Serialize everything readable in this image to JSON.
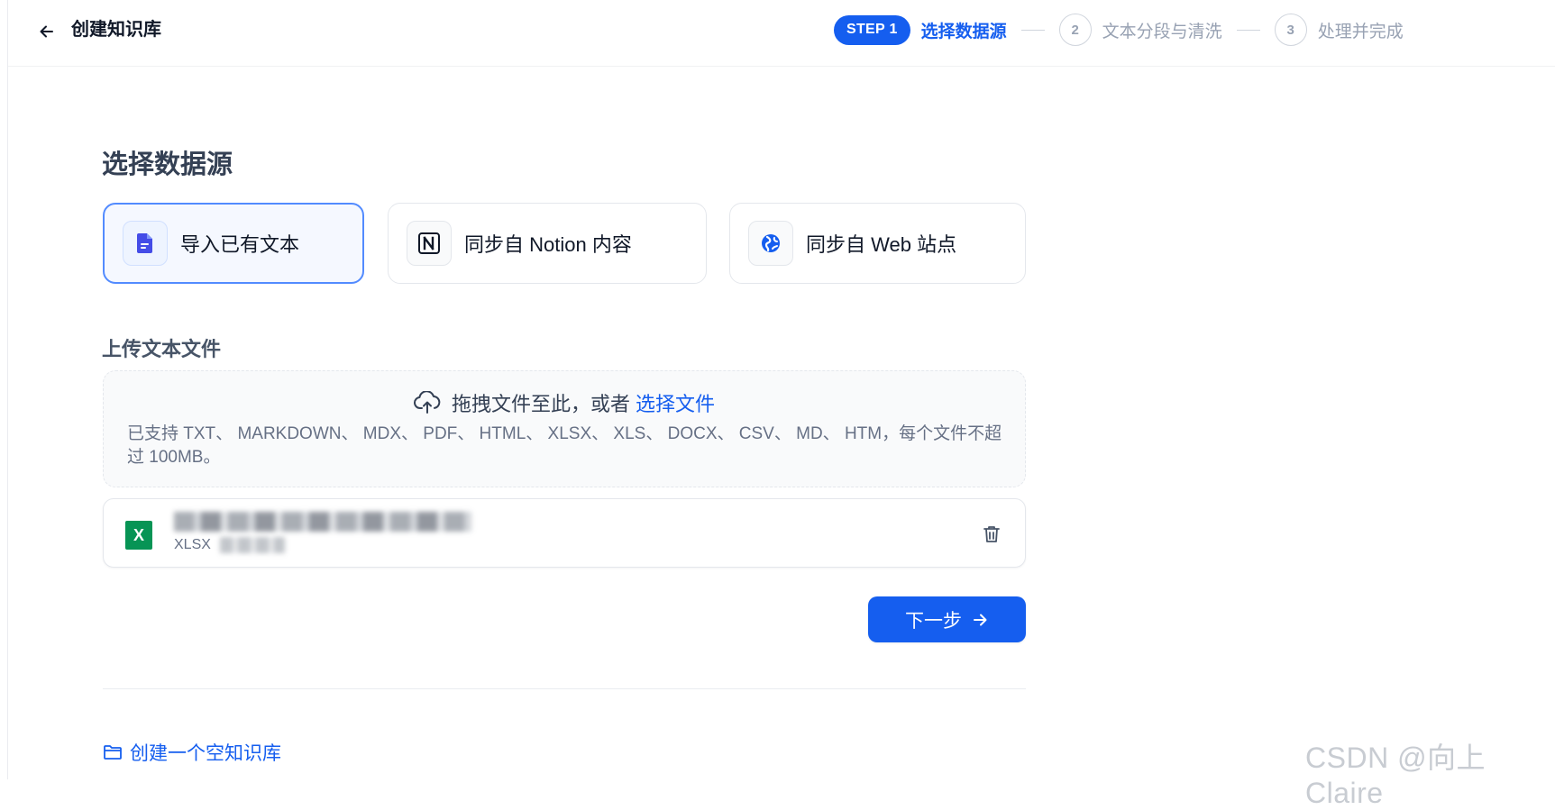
{
  "header": {
    "title": "创建知识库",
    "back_icon": "arrow-left-icon"
  },
  "stepper": {
    "active_badge": "STEP 1",
    "active_label": "选择数据源",
    "steps": [
      {
        "number": "2",
        "label": "文本分段与清洗"
      },
      {
        "number": "3",
        "label": "处理并完成"
      }
    ]
  },
  "main": {
    "title": "选择数据源",
    "sources": [
      {
        "label": "导入已有文本",
        "icon": "document-icon",
        "selected": true
      },
      {
        "label": "同步自 Notion 内容",
        "icon": "notion-icon",
        "selected": false
      },
      {
        "label": "同步自 Web 站点",
        "icon": "globe-icon",
        "selected": false
      }
    ],
    "upload": {
      "title": "上传文本文件",
      "drop_text": "拖拽文件至此，或者",
      "drop_link": "选择文件",
      "hint": "已支持 TXT、 MARKDOWN、 MDX、 PDF、 HTML、 XLSX、 XLS、 DOCX、 CSV、 MD、 HTM，每个文件不超过 100MB。"
    },
    "file": {
      "type": "XLSX",
      "icon_letter": "X"
    },
    "next_label": "下一步",
    "create_empty_label": "创建一个空知识库"
  },
  "watermark": "CSDN @向上Claire",
  "colors": {
    "accent": "#155eef",
    "excel": "#079455"
  }
}
